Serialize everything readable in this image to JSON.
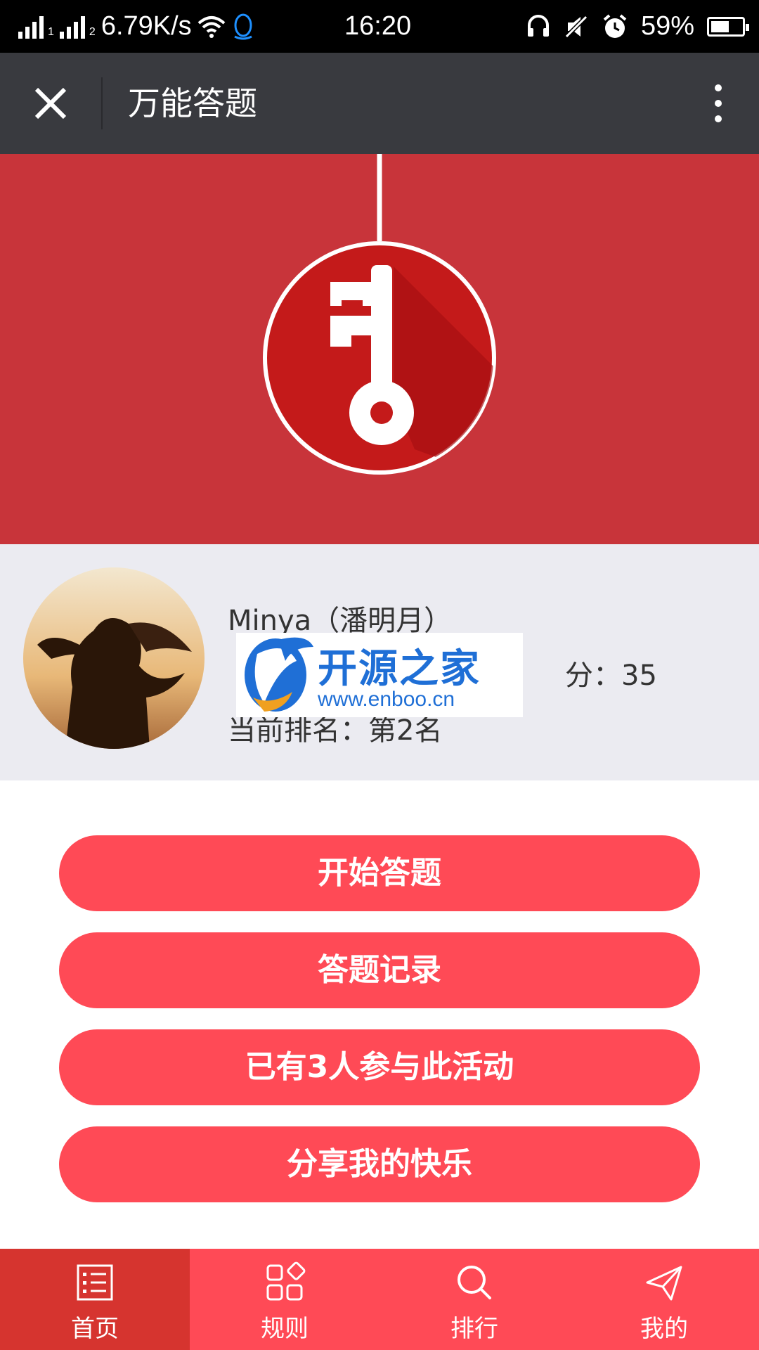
{
  "statusbar": {
    "network_speed": "6.79K/s",
    "time": "16:20",
    "battery": "59%",
    "battery_level": 0.59,
    "sim1": "1",
    "sim2": "2"
  },
  "titlebar": {
    "title": "万能答题"
  },
  "hero": {
    "icon": "key-icon",
    "bg_color": "#c8343a"
  },
  "profile": {
    "name": "Minya（潘明月）",
    "score": "分：35",
    "rank": "当前排名：第2名"
  },
  "watermark": {
    "text": "开源之家",
    "url": "www.enboo.cn"
  },
  "actions": [
    {
      "label": "开始答题"
    },
    {
      "label": "答题记录"
    },
    {
      "label": "已有3人参与此活动"
    },
    {
      "label": "分享我的快乐"
    }
  ],
  "bottomnav": [
    {
      "label": "首页",
      "icon": "list-icon",
      "active": true
    },
    {
      "label": "规则",
      "icon": "grid-icon",
      "active": false
    },
    {
      "label": "排行",
      "icon": "search-icon",
      "active": false
    },
    {
      "label": "我的",
      "icon": "send-icon",
      "active": false
    }
  ],
  "colors": {
    "accent": "#ff4a56",
    "active_tab": "#d6342f",
    "titlebar": "#393a3f"
  }
}
